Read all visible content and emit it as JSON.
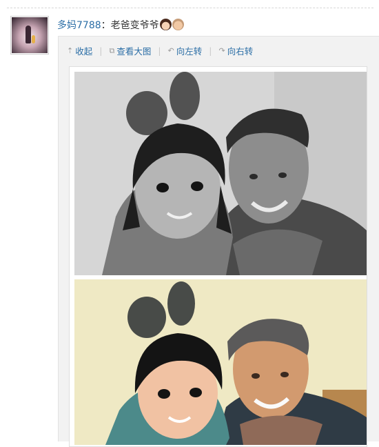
{
  "post": {
    "username": "多妈7788",
    "separator": "：",
    "text": "老爸变爷爷",
    "emoticons": [
      "girl-face-emoticon",
      "grandpa-face-emoticon"
    ]
  },
  "toolbar": {
    "collapse": "收起",
    "view_large": "查看大图",
    "rotate_left": "向左转",
    "rotate_right": "向右转"
  },
  "images": [
    {
      "name": "black-white-photo",
      "style": "grayscale"
    },
    {
      "name": "color-photo",
      "style": "warm color"
    }
  ],
  "colors": {
    "link": "#2b6ea6",
    "panel_bg": "#f2f2f2"
  }
}
